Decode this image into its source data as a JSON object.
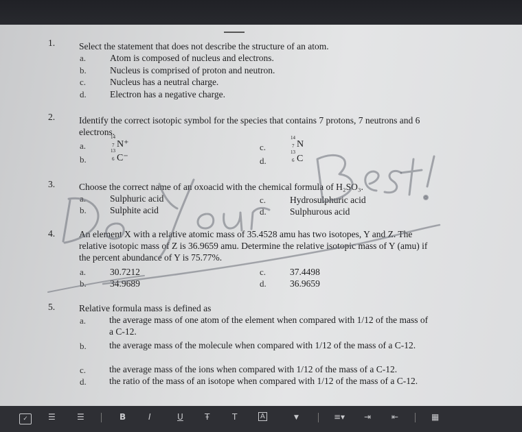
{
  "questions": [
    {
      "num": "1.",
      "stem": "Select the statement that does not describe the structure of an atom.",
      "options": [
        {
          "letter": "a.",
          "text": "Atom is composed of nucleus and electrons."
        },
        {
          "letter": "b.",
          "text": "Nucleus is comprised of proton and neutron."
        },
        {
          "letter": "c.",
          "text": "Nucleus has a neutral charge."
        },
        {
          "letter": "d.",
          "text": "Electron has a negative charge."
        }
      ]
    },
    {
      "num": "2.",
      "stem": "Identify the correct isotopic symbol for the species that contains 7 protons, 7 neutrons and 6 electrons.",
      "options": [
        {
          "letter": "a.",
          "mass": "14",
          "atomic": "7",
          "symbol": "N⁺"
        },
        {
          "letter": "b.",
          "mass": "13",
          "atomic": "6",
          "symbol": "C⁻"
        },
        {
          "letter": "c.",
          "mass": "14",
          "atomic": "7",
          "symbol": "N"
        },
        {
          "letter": "d.",
          "mass": "13",
          "atomic": "6",
          "symbol": "C"
        }
      ]
    },
    {
      "num": "3.",
      "stem": "Choose the correct name of an oxoacid with the chemical formula of H₂SO₃.",
      "options": [
        {
          "letter": "a.",
          "text": "Sulphuric acid"
        },
        {
          "letter": "b.",
          "text": "Sulphite acid"
        },
        {
          "letter": "c.",
          "text": "Hydrosulphuric acid"
        },
        {
          "letter": "d.",
          "text": "Sulphurous acid"
        }
      ]
    },
    {
      "num": "4.",
      "stem": "An element X with a relative atomic mass of 35.4528 amu has two isotopes, Y and Z. The relative isotopic mass of Z is 36.9659 amu. Determine the relative isotopic mass of Y (amu) if the percent abundance of Y is 75.77%.",
      "options": [
        {
          "letter": "a.",
          "text": "30.7212"
        },
        {
          "letter": "b.",
          "text": "34.9689"
        },
        {
          "letter": "c.",
          "text": "37.4498"
        },
        {
          "letter": "d.",
          "text": "36.9659"
        }
      ]
    },
    {
      "num": "5.",
      "stem": "Relative formula mass is defined as",
      "options": [
        {
          "letter": "a.",
          "text": "the average mass of one atom of the element when compared with 1/12 of the mass of a C-12."
        },
        {
          "letter": "b.",
          "text": "the average mass of the molecule when compared with 1/12 of the mass of a C-12."
        },
        {
          "letter": "c.",
          "text": "the average mass of the ions when compared with 1/12 of the mass of a C-12."
        },
        {
          "letter": "d.",
          "text": "the ratio of the mass of an isotope when compared with 1/12 of the mass of a C-12."
        }
      ]
    }
  ],
  "watermark": {
    "text": "Do Your Best!",
    "color": "#6b6f78"
  },
  "toolbar": {
    "bold": "B",
    "italic": "I",
    "underline": "U",
    "strike": "Ŧ",
    "text": "T"
  }
}
